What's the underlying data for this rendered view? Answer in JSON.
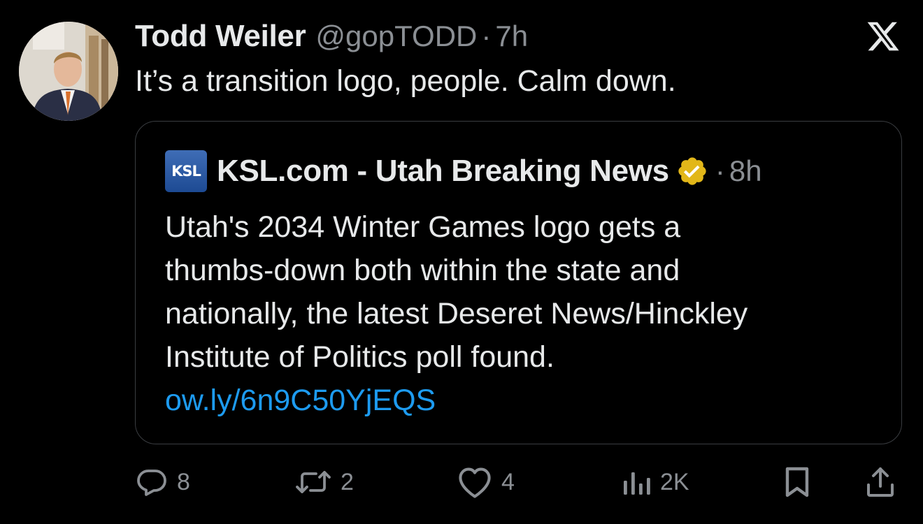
{
  "tweet": {
    "author_name": "Todd Weiler",
    "handle": "@gopTODD",
    "separator": "·",
    "time": "7h",
    "text": "It’s a transition logo, people. Calm down."
  },
  "quote": {
    "avatar_text": "KSL",
    "author_name": "KSL.com - Utah Breaking News",
    "separator": "·",
    "time": "8h",
    "lines": [
      "Utah's 2034 Winter Games logo gets a",
      "thumbs-down both within the state and",
      "nationally, the latest Deseret News/Hinckley",
      "Institute of Politics poll found."
    ],
    "link": "ow.ly/6n9C50YjEQS"
  },
  "actions": {
    "replies": "8",
    "reposts": "2",
    "likes": "4",
    "views": "2K"
  },
  "colors": {
    "background": "#000000",
    "text": "#e7e9ea",
    "secondary": "#8b8f94",
    "link": "#1d9bf0",
    "verified": "#e2b719",
    "border": "#3a3d41"
  },
  "icons": [
    "x-logo-icon",
    "verified-badge-icon",
    "reply-icon",
    "repost-icon",
    "like-icon",
    "views-icon",
    "bookmark-icon",
    "share-icon"
  ]
}
